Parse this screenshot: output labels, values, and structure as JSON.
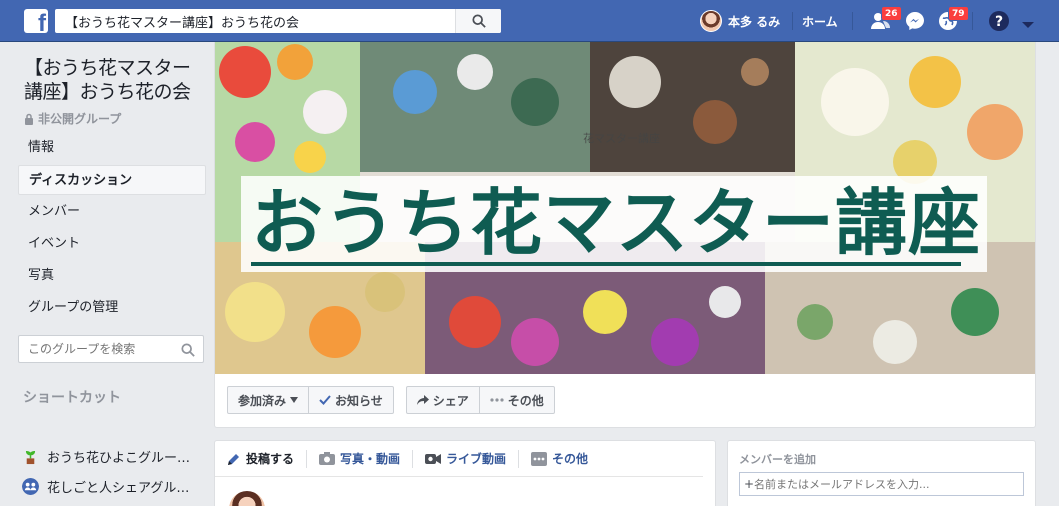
{
  "topbar": {
    "logo_letter": "f",
    "search_value": "【おうち花マスター講座】おうち花の会",
    "user_name": "本多 るみ",
    "home_label": "ホーム",
    "friend_badge": "26",
    "notification_badge": "79",
    "brand_color": "#4267b2"
  },
  "left": {
    "group_name": "【おうち花マスター講座】おうち花の会",
    "privacy": "非公開グループ",
    "nav": [
      {
        "label": "情報"
      },
      {
        "label": "ディスカッション"
      },
      {
        "label": "メンバー"
      },
      {
        "label": "イベント"
      },
      {
        "label": "写真"
      },
      {
        "label": "グループの管理"
      }
    ],
    "group_search_placeholder": "このグループを検索",
    "shortcuts_title": "ショートカット",
    "shortcuts": [
      {
        "label": "おうち花ひよこグルー…"
      },
      {
        "label": "花しごと人シェアグル…"
      }
    ]
  },
  "cover": {
    "title": "おうち花マスター講座",
    "small_text": "花マスター講座"
  },
  "actions": {
    "joined": "参加済み",
    "notifications": "お知らせ",
    "share": "シェア",
    "more": "その他"
  },
  "composer": {
    "tabs": [
      {
        "label": "投稿する"
      },
      {
        "label": "写真・動画"
      },
      {
        "label": "ライブ動画"
      },
      {
        "label": "その他"
      }
    ]
  },
  "add_member": {
    "title": "メンバーを追加",
    "placeholder": "名前またはメールアドレスを入力..."
  }
}
